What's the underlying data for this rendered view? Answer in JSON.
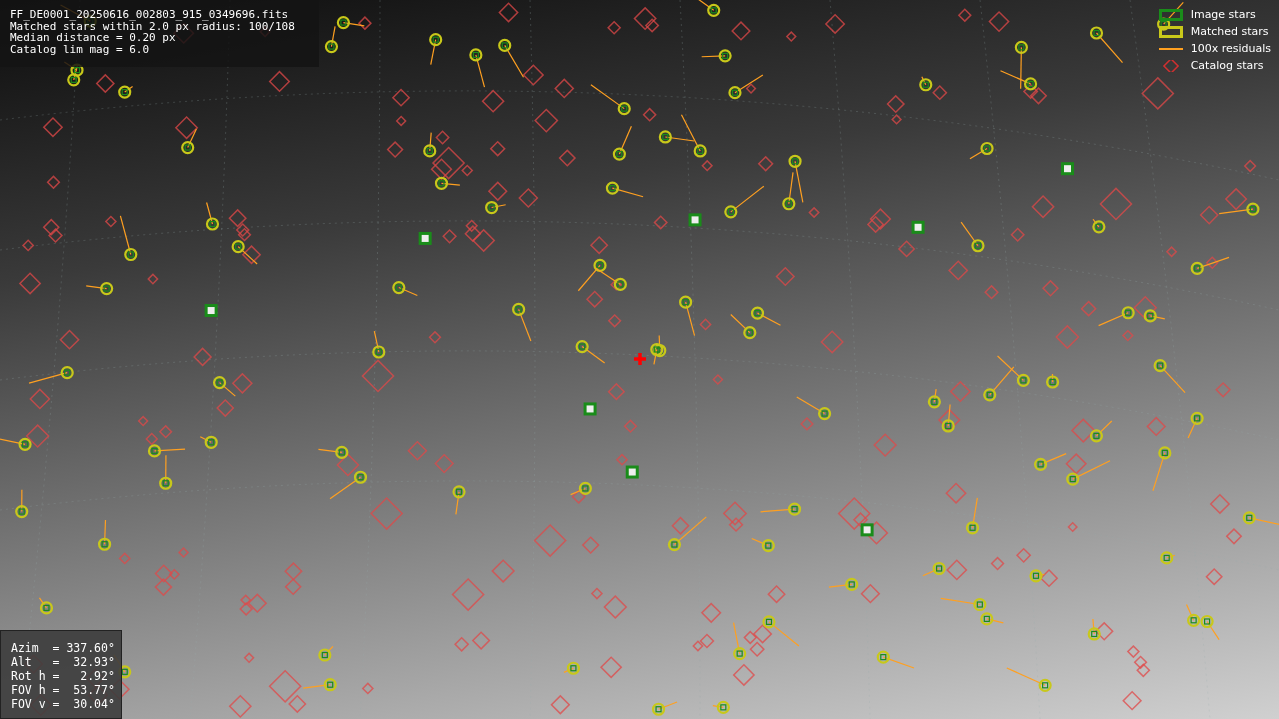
{
  "info_panel": {
    "lines": [
      "FF_DE0001_20250616_002803_915_0349696.fits",
      "Matched stars within 2.0 px radius: 100/108",
      "Median distance = 0.20 px",
      "Catalog lim mag = 6.0"
    ]
  },
  "legend": [
    {
      "label": "Image stars",
      "kind": "box",
      "color": "#1a8c1a"
    },
    {
      "label": "Matched stars",
      "kind": "box",
      "color": "#c8c81a"
    },
    {
      "label": "100x residuals",
      "kind": "line",
      "color": "#ffa020"
    },
    {
      "label": "Catalog stars",
      "kind": "diamond",
      "color": "#d03030"
    }
  ],
  "pointing_panel": {
    "lines": [
      "Azim  = 337.60°",
      "Alt   =  32.93°",
      "Rot h =   2.92°",
      "FOV h =  53.77°",
      "FOV v =  30.04°"
    ]
  }
}
